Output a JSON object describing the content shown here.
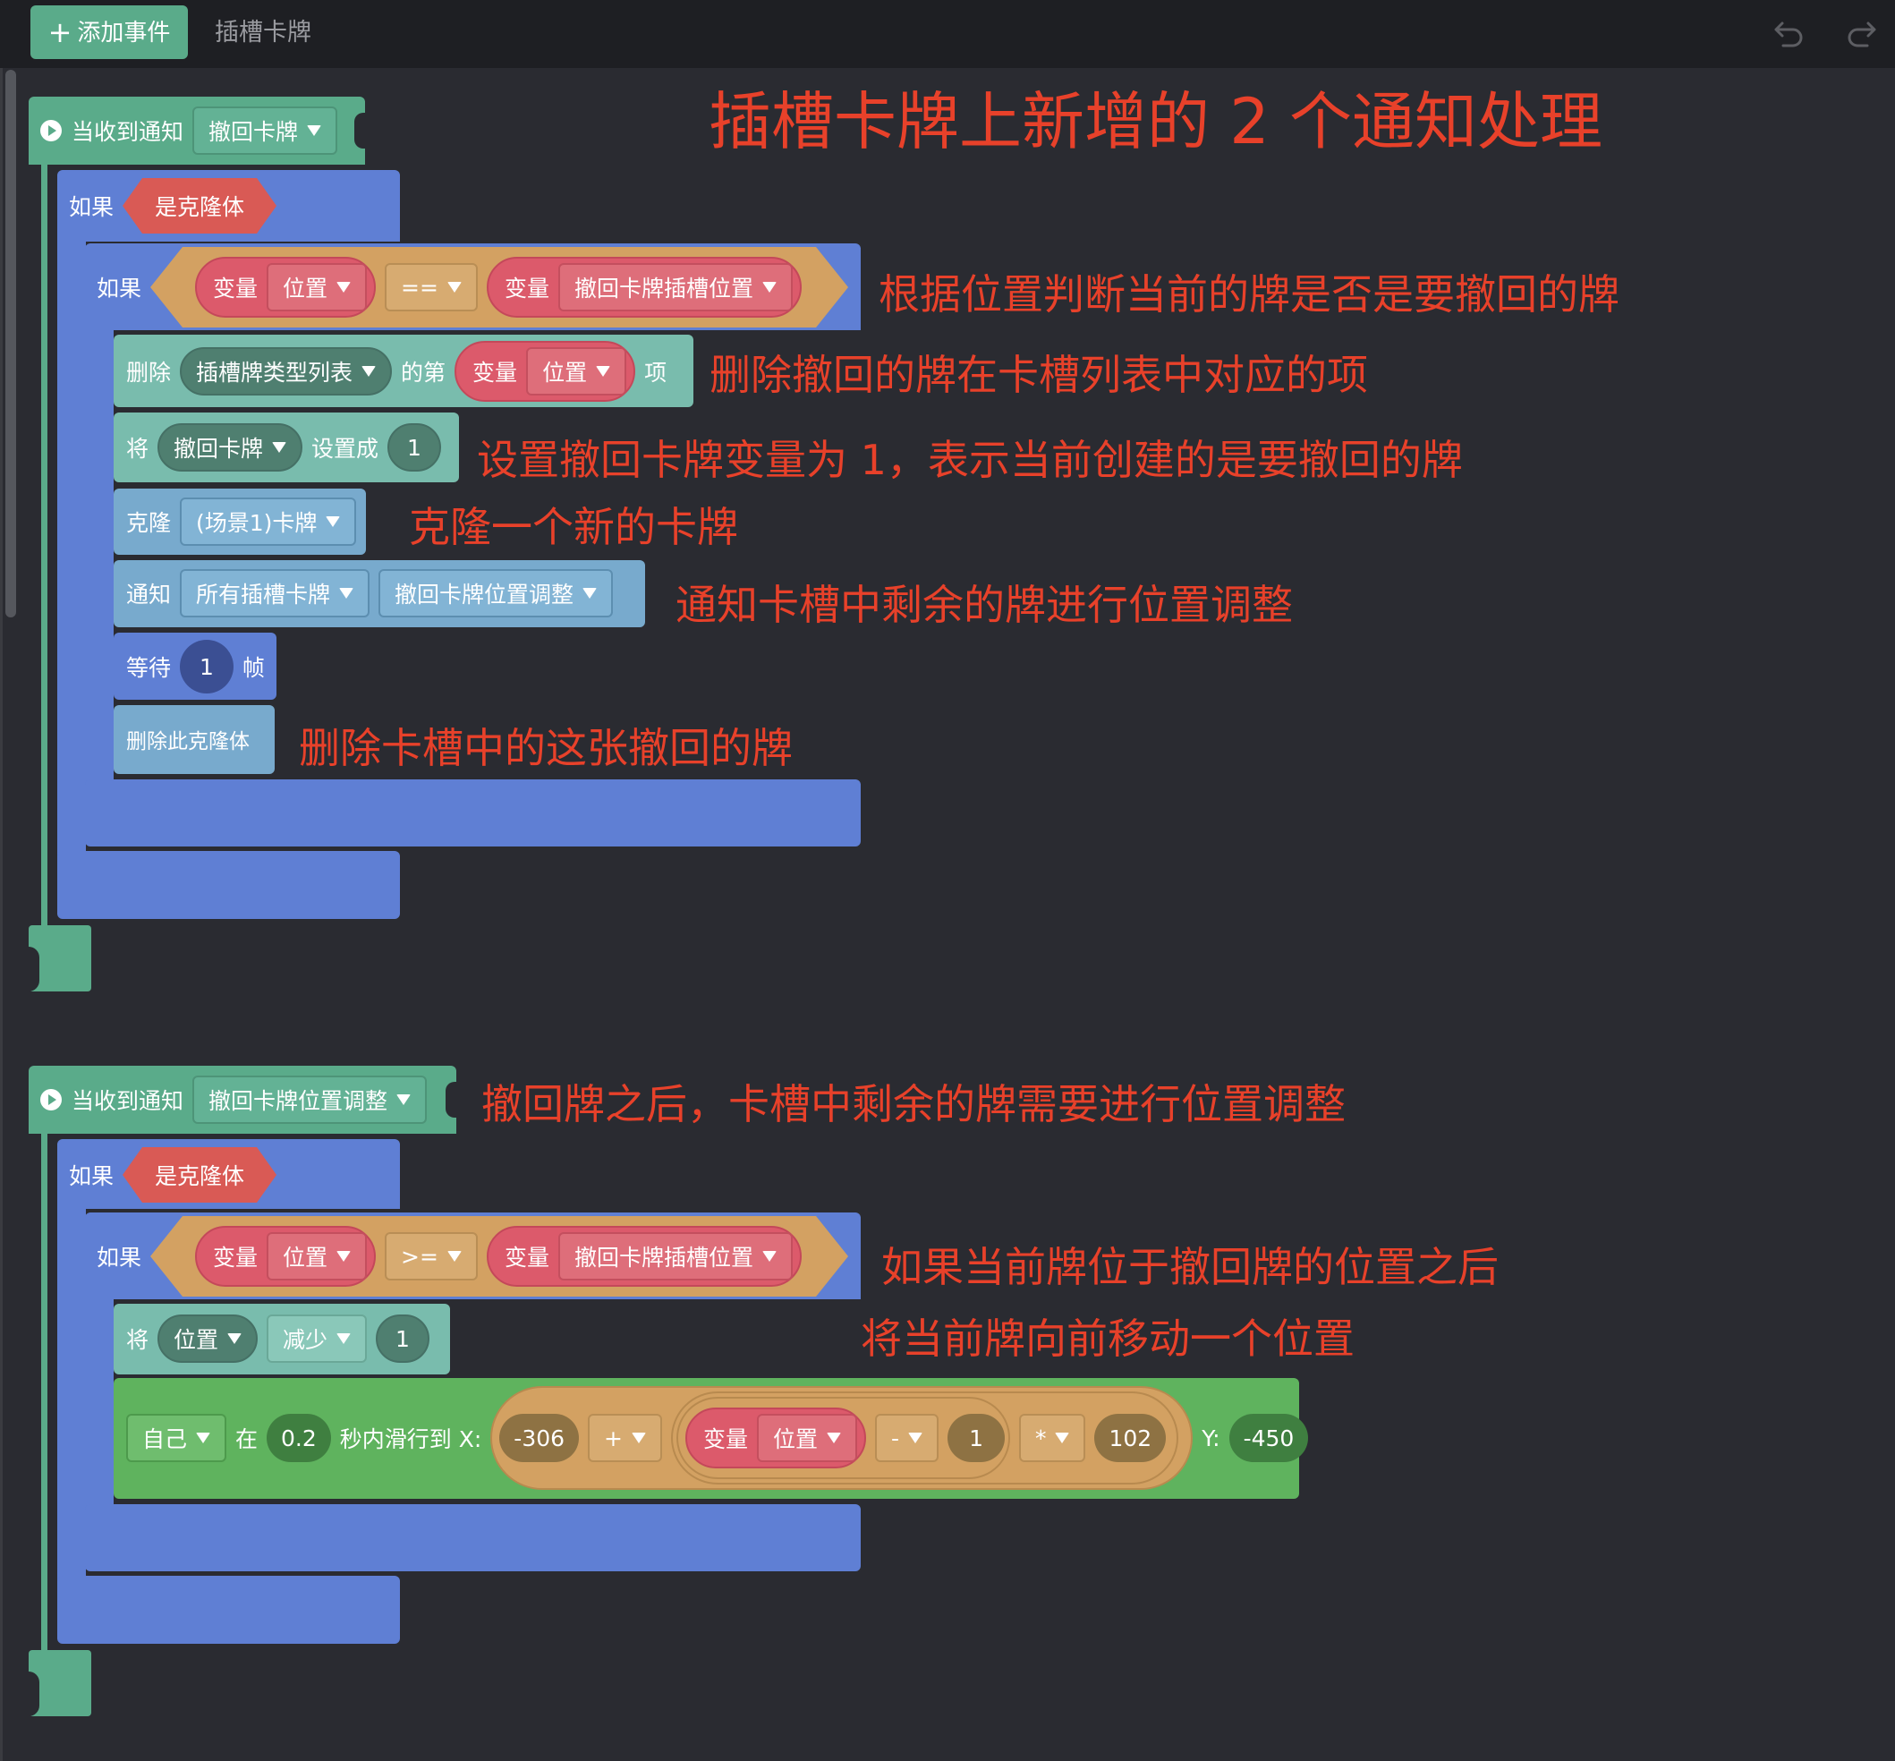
{
  "toolbar": {
    "add_event_label": "添加事件",
    "add_event_icon": "plus-icon",
    "tab_title": "插槽卡牌",
    "undo_icon": "undo-icon",
    "redo_icon": "redo-icon"
  },
  "event1": {
    "hat_label": "当收到通知",
    "hat_icon": "play-circle-icon",
    "message": "撤回卡牌",
    "if_outer_label": "如果",
    "is_clone_label": "是克隆体",
    "if_inner_label": "如果",
    "cond": {
      "left_var_label": "变量",
      "left_var": "位置",
      "op": "==",
      "right_var_label": "变量",
      "right_var": "撤回卡牌插槽位置"
    },
    "delete_item": {
      "label": "删除",
      "list": "插槽牌类型列表",
      "of_label": "的第",
      "var_label": "变量",
      "var": "位置",
      "item_label": "项"
    },
    "set_var": {
      "label": "将",
      "var": "撤回卡牌",
      "to_label": "设置成",
      "value": "1"
    },
    "clone": {
      "label": "克隆",
      "target": "(场景1)卡牌"
    },
    "notify": {
      "label": "通知",
      "target": "所有插槽卡牌",
      "message": "撤回卡牌位置调整"
    },
    "wait": {
      "label": "等待",
      "value": "1",
      "unit": "帧"
    },
    "delete_clone_label": "删除此克隆体"
  },
  "event2": {
    "hat_label": "当收到通知",
    "hat_icon": "play-circle-icon",
    "message": "撤回卡牌位置调整",
    "if_outer_label": "如果",
    "is_clone_label": "是克隆体",
    "if_inner_label": "如果",
    "cond": {
      "left_var_label": "变量",
      "left_var": "位置",
      "op": ">=",
      "right_var_label": "变量",
      "right_var": "撤回卡牌插槽位置"
    },
    "change_var": {
      "label": "将",
      "var": "位置",
      "mode": "减少",
      "value": "1"
    },
    "glide": {
      "target": "自己",
      "in_label": "在",
      "seconds": "0.2",
      "glide_label": "秒内滑行到 X:",
      "x_base": "-306",
      "op1": "+",
      "var_label": "变量",
      "var": "位置",
      "op2": "-",
      "sub_value": "1",
      "op3": "*",
      "mul_value": "102",
      "y_label": "Y:",
      "y_value": "-450"
    }
  },
  "annotations": {
    "title": "插槽卡牌上新增的 2 个通知处理",
    "a1": "根据位置判断当前的牌是否是要撤回的牌",
    "a2": "删除撤回的牌在卡槽列表中对应的项",
    "a3": "设置撤回卡牌变量为 1，表示当前创建的是要撤回的牌",
    "a4": "克隆一个新的卡牌",
    "a5": "通知卡槽中剩余的牌进行位置调整",
    "a6": "删除卡槽中的这张撤回的牌",
    "a7": "撤回牌之后，卡槽中剩余的牌需要进行位置调整",
    "a8": "如果当前牌位于撤回牌的位置之后",
    "a9": "将当前牌向前移动一个位置"
  },
  "colors": {
    "annotation": "#e8412a",
    "event": "#5aab8a",
    "control": "#5f7fd4",
    "data": "#79bcad",
    "clone": "#78aacd",
    "motion": "#5fb35e",
    "operator": "#d3a162",
    "variable": "#dc5a6b"
  }
}
